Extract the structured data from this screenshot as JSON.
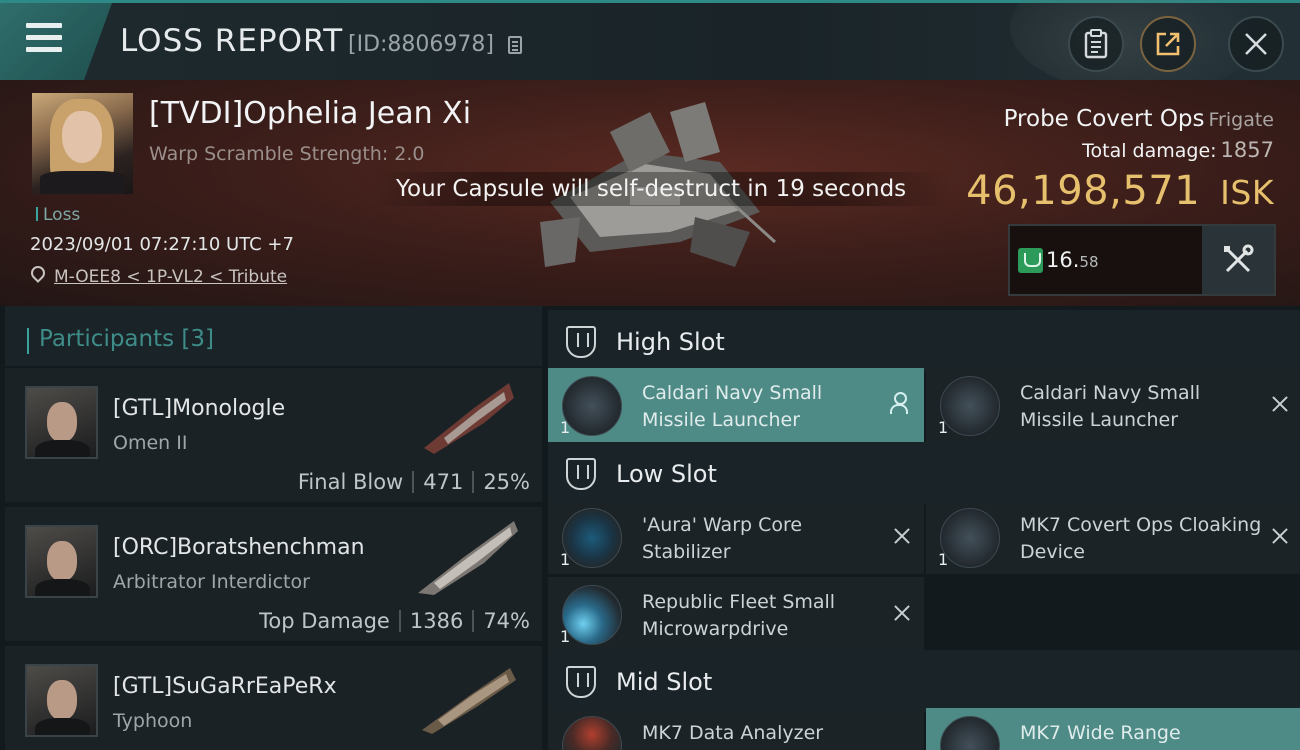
{
  "header": {
    "title": "LOSS REPORT",
    "report_id": "[ID:8806978]"
  },
  "victim": {
    "name": "[TVDI]Ophelia Jean Xi",
    "warp_scramble": "Warp Scramble Strength: 2.0",
    "loss_tag": "Loss",
    "datetime": "2023/09/01 07:27:10 UTC +7",
    "location": "M-OEE8 < 1P-VL2 < Tribute",
    "capsule_message": "Your Capsule will self-destruct in 19 seconds",
    "ship_name": "Probe Covert Ops",
    "ship_class": "Frigate",
    "total_damage_label": "Total damage:",
    "total_damage": "1857",
    "isk_value": "46,198,571",
    "isk_unit": "ISK",
    "security_main": "16.",
    "security_decimal": "58"
  },
  "participants": {
    "title": "Participants",
    "count": "[3]",
    "rows": [
      {
        "name": "[GTL]Monologle",
        "ship": "Omen II",
        "role": "Final Blow",
        "damage": "471",
        "percent": "25%"
      },
      {
        "name": "[ORC]Boratshenchman",
        "ship": "Arbitrator Interdictor",
        "role": "Top Damage",
        "damage": "1386",
        "percent": "74%"
      },
      {
        "name": "[GTL]SuGaRrEaPeRx",
        "ship": "Typhoon",
        "role": "",
        "damage": "",
        "percent": ""
      }
    ]
  },
  "slots": {
    "high": {
      "label": "High Slot",
      "modules": [
        {
          "name": "Caldari Navy Small Missile Launcher",
          "qty": "1",
          "state": "pilot"
        },
        {
          "name": "Caldari Navy Small Missile Launcher",
          "qty": "1",
          "state": "destroyed"
        }
      ]
    },
    "low": {
      "label": "Low Slot",
      "modules": [
        {
          "name": "'Aura' Warp Core Stabilizer",
          "qty": "1",
          "state": "destroyed"
        },
        {
          "name": "MK7 Covert Ops Cloaking Device",
          "qty": "1",
          "state": "destroyed"
        },
        {
          "name": "Republic Fleet Small Microwarpdrive",
          "qty": "1",
          "state": "destroyed"
        }
      ]
    },
    "mid": {
      "label": "Mid Slot",
      "modules": [
        {
          "name": "MK7 Data Analyzer",
          "qty": "",
          "state": "destroyed"
        },
        {
          "name": "MK7 Wide Range",
          "qty": "",
          "state": "dropped"
        }
      ]
    }
  },
  "icons": [
    "menu-icon",
    "copy-icon",
    "clipboard-icon",
    "share-icon",
    "close-icon",
    "location-pin-icon",
    "security-shield-icon",
    "fitting-tools-icon",
    "slot-shield-icon",
    "pilot-icon",
    "destroyed-x-icon"
  ],
  "colors": {
    "accent": "#3aa39c",
    "isk": "#e7c06d",
    "highlight": "#4e8a86",
    "banner": "#3d1e1a"
  }
}
